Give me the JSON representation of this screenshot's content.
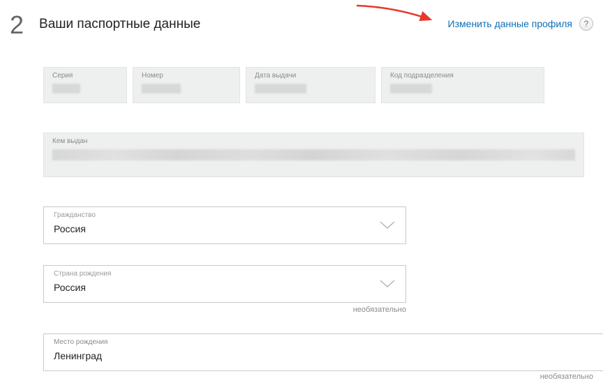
{
  "step": "2",
  "title": "Ваши паспортные данные",
  "change_link": "Изменить данные профиля",
  "help_symbol": "?",
  "fields": {
    "series_label": "Серия",
    "number_label": "Номер",
    "issue_date_label": "Дата выдачи",
    "dept_code_label": "Код подразделения",
    "issued_by_label": "Кем выдан"
  },
  "citizenship": {
    "label": "Гражданство",
    "value": "Россия"
  },
  "birth_country": {
    "label": "Страна рождения",
    "value": "Россия",
    "optional": "необязательно"
  },
  "birth_place": {
    "label": "Место рождения",
    "value": "Ленинград",
    "optional": "необязательно"
  }
}
